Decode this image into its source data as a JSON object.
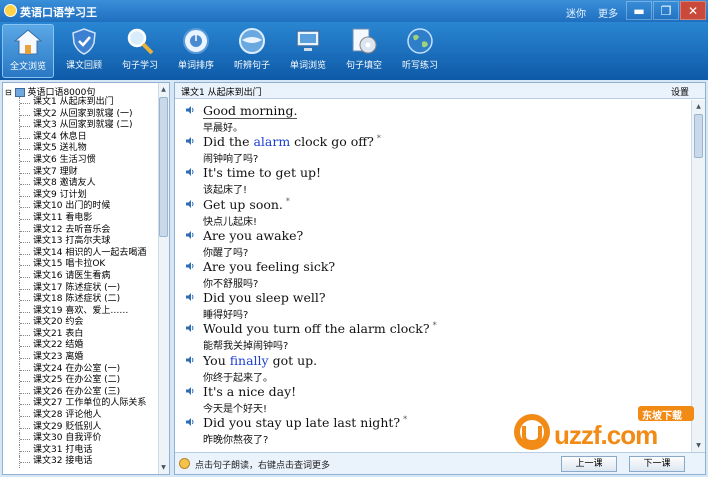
{
  "window": {
    "title": "英语口语学习王",
    "links": [
      "迷你",
      "更多"
    ],
    "controls": [
      "▬",
      "❐",
      "✕"
    ]
  },
  "toolbar": [
    {
      "label": "全文浏览",
      "icon": "house-icon",
      "active": true
    },
    {
      "label": "课文回顾",
      "icon": "shield-icon"
    },
    {
      "label": "句子学习",
      "icon": "magnifier-icon"
    },
    {
      "label": "单词排序",
      "icon": "clock-icon"
    },
    {
      "label": "听辨句子",
      "icon": "globe-icon"
    },
    {
      "label": "单词浏览",
      "icon": "monitor-icon"
    },
    {
      "label": "句子填空",
      "icon": "disc-icon"
    },
    {
      "label": "听写练习",
      "icon": "earth-icon"
    }
  ],
  "tree": {
    "root": "英语口语8000句",
    "items": [
      "课文1 从起床到出门",
      "课文2 从回家到就寝 (一)",
      "课文3 从回家到就寝 (二)",
      "课文4 休息日",
      "课文5 送礼物",
      "课文6 生活习惯",
      "课文7 理财",
      "课文8 邀请友人",
      "课文9 订计划",
      "课文10 出门的时候",
      "课文11 看电影",
      "课文12 去听音乐会",
      "课文13 打高尔夫球",
      "课文14 相识的人一起去喝酒",
      "课文15 唱卡拉OK",
      "课文16 请医生看病",
      "课文17 陈述症状 (一)",
      "课文18 陈述症状 (二)",
      "课文19 喜欢、爱上……",
      "课文20 约会",
      "课文21 表白",
      "课文22 结婚",
      "课文23 离婚",
      "课文24 在办公室 (一)",
      "课文25 在办公室 (二)",
      "课文26 在办公室 (三)",
      "课文27 工作单位的人际关系",
      "课文28 评论他人",
      "课文29 贬低别人",
      "课文30 自我评价",
      "课文31 打电话",
      "课文32 接电话"
    ]
  },
  "main": {
    "lesson_title": "课文1 从起床到出门",
    "settings": "设置",
    "sentences": [
      {
        "en": [
          "Good morning."
        ],
        "zh": "早晨好。"
      },
      {
        "en": [
          "Did the ",
          "alarm",
          " clock go off?"
        ],
        "zh": "闹钟响了吗?",
        "star": "*"
      },
      {
        "en": [
          "It's time to get up!"
        ],
        "zh": "该起床了!"
      },
      {
        "en": [
          "Get up soon."
        ],
        "zh": "快点儿起床!",
        "star": "*"
      },
      {
        "en": [
          "Are you awake?"
        ],
        "zh": "你醒了吗?"
      },
      {
        "en": [
          "Are you feeling sick?"
        ],
        "zh": "你不舒服吗?"
      },
      {
        "en": [
          "Did you sleep well?"
        ],
        "zh": "睡得好吗?"
      },
      {
        "en": [
          "Would you turn off the alarm clock?"
        ],
        "zh": "能帮我关掉闹钟吗?",
        "star": "*"
      },
      {
        "en": [
          "You ",
          "finally",
          " got up."
        ],
        "zh": "你终于起来了。"
      },
      {
        "en": [
          "It's a nice day!"
        ],
        "zh": "今天是个好天!"
      },
      {
        "en": [
          "Did you stay up late last night?"
        ],
        "zh": "昨晚你熬夜了?",
        "star": "*"
      }
    ],
    "hint": "点击句子朗读，右键点击查词更多",
    "prev": "上一课",
    "next": "下一课"
  },
  "watermark": {
    "text": "uzzf.com",
    "badge": "东坡下载"
  },
  "colors": {
    "toolbar": "#1f6fc0",
    "highlight": "#1c3fd0",
    "watermark_orange": "#f28a16"
  }
}
